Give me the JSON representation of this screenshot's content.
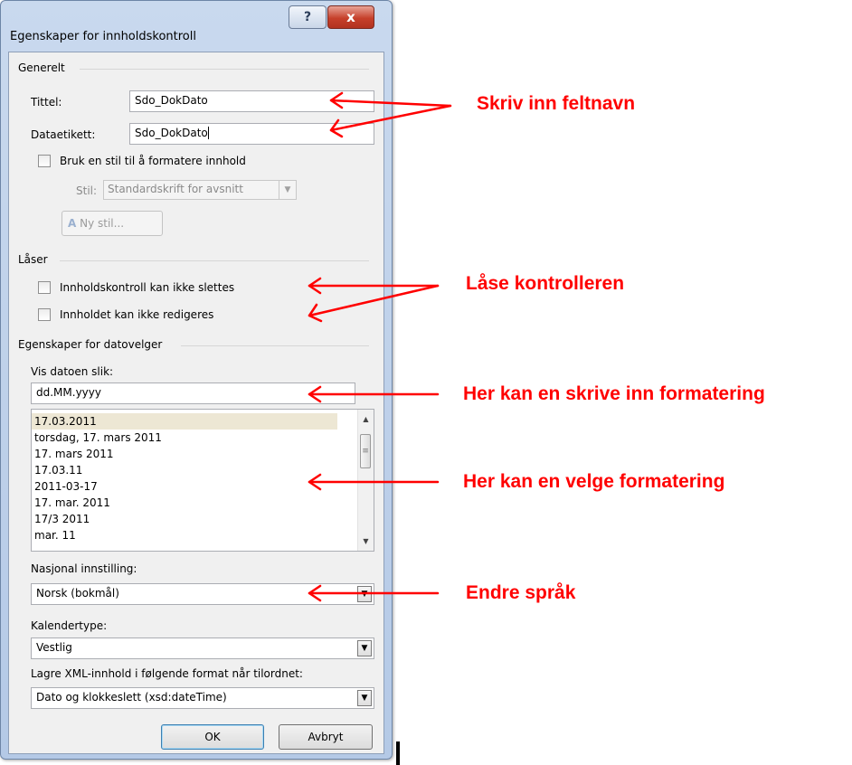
{
  "dialog": {
    "title": "Egenskaper for innholdskontroll",
    "help_glyph": "?",
    "close_glyph": "x"
  },
  "general": {
    "section_label": "Generelt",
    "title_label": "Tittel:",
    "title_value": "Sdo_DokDato",
    "tag_label": "Dataetikett:",
    "tag_value": "Sdo_DokDato",
    "use_style_label": "Bruk en stil til å formatere innhold",
    "style_label": "Stil:",
    "style_value": "Standardskrift for avsnitt",
    "new_style_label": "Ny stil..."
  },
  "locking": {
    "section_label": "Låser",
    "cannot_delete_label": "Innholdskontroll kan ikke slettes",
    "cannot_edit_label": "Innholdet kan ikke redigeres"
  },
  "date_picker": {
    "section_label": "Egenskaper for datovelger",
    "display_label": "Vis datoen slik:",
    "format_value": "dd.MM.yyyy",
    "formats": [
      "17.03.2011",
      "torsdag, 17. mars 2011",
      "17. mars 2011",
      "17.03.11",
      "2011-03-17",
      "17. mar. 2011",
      "17/3 2011",
      "mar. 11"
    ],
    "locale_label": "Nasjonal innstilling:",
    "locale_value": "Norsk (bokmål)",
    "calendar_label": "Kalendertype:",
    "calendar_value": "Vestlig",
    "xml_label": "Lagre XML-innhold i følgende format når tilordnet:",
    "xml_value": "Dato og klokkeslett (xsd:dateTime)"
  },
  "buttons": {
    "ok_label": "OK",
    "cancel_label": "Avbryt"
  },
  "annotations": {
    "field_name": "Skriv inn feltnavn",
    "lock": "Låse kontrolleren",
    "type_format": "Her kan en skrive inn formatering",
    "choose_format": "Her kan en velge formatering",
    "language": "Endre språk",
    "color": "#ff0000"
  }
}
